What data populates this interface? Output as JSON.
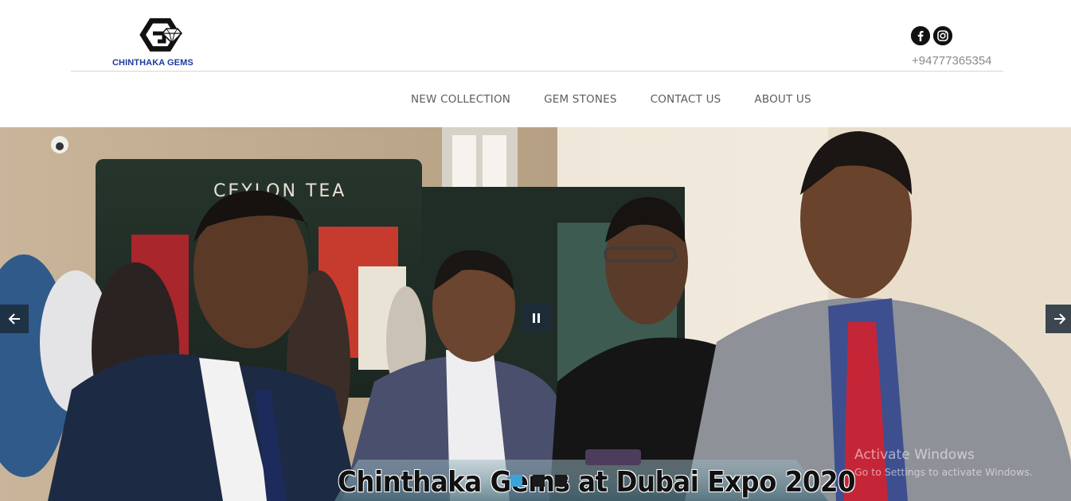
{
  "brand": {
    "name": "CHINTHAKA GEMS",
    "logo_icon": "diamond-g-logo"
  },
  "contact": {
    "phone": "+94777365354",
    "social": [
      {
        "name": "facebook",
        "glyph": "f"
      },
      {
        "name": "instagram",
        "glyph": "instagram-icon"
      }
    ]
  },
  "nav": {
    "items": [
      {
        "label": "NEW COLLECTION"
      },
      {
        "label": "GEM STONES"
      },
      {
        "label": "CONTACT US"
      },
      {
        "label": "ABOUT US"
      }
    ]
  },
  "slider": {
    "caption": "Chinthaka Gems at Dubai Expo 2020",
    "background_sign": "CEYLON TEA",
    "prev_icon": "arrow-left-icon",
    "next_icon": "arrow-right-icon",
    "pause_icon": "pause-icon",
    "dots": [
      {
        "active": true
      },
      {
        "active": false
      },
      {
        "active": false
      }
    ]
  },
  "os_overlay": {
    "title": "Activate Windows",
    "subtitle": "Go to Settings to activate Windows."
  },
  "colors": {
    "accent": "#3aa3d8",
    "nav_text": "#5d5d5d",
    "brand_blue": "#1b3c9c",
    "arrow_bg": "#1c2c38"
  }
}
